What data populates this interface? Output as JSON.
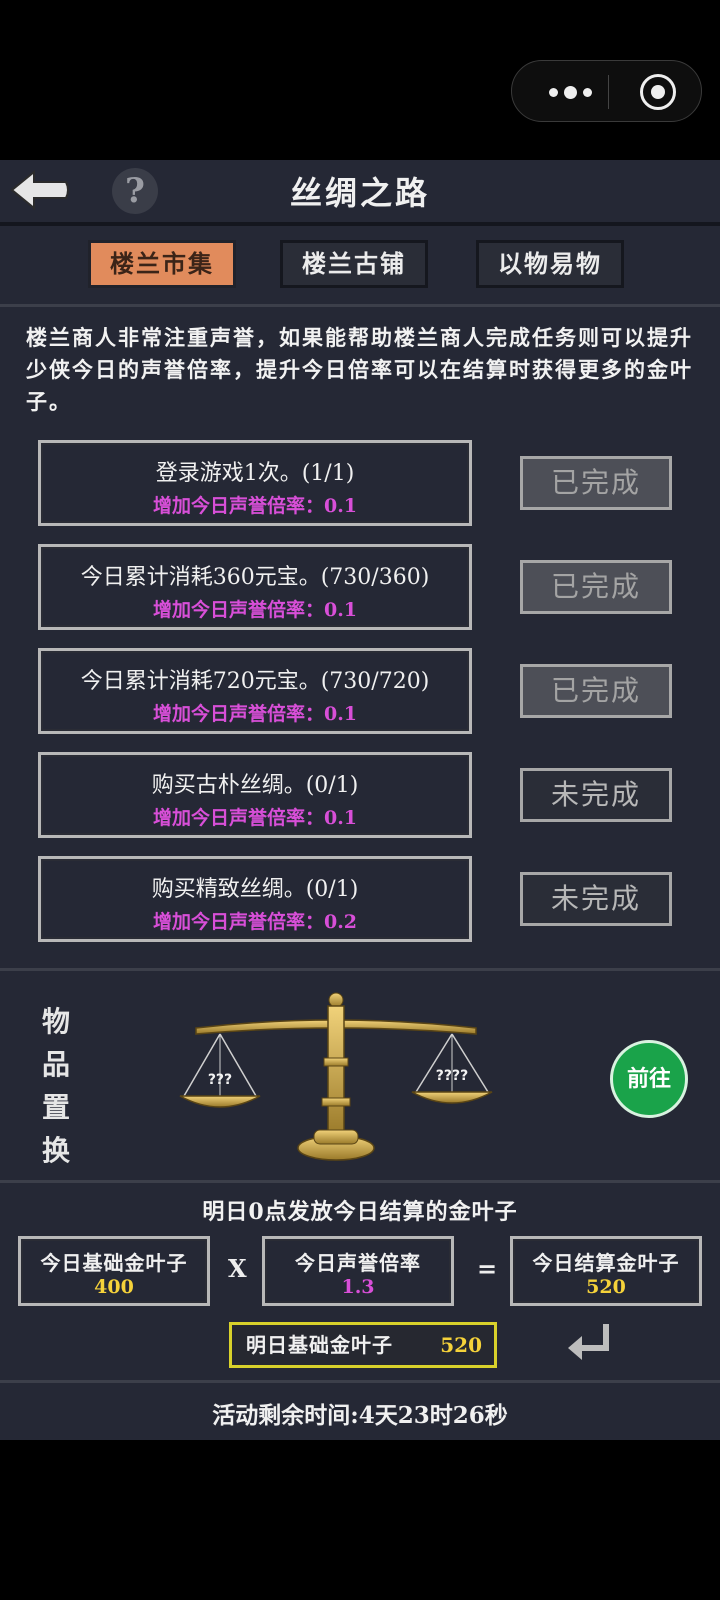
{
  "capsule": {
    "more_icon": "more-dots-icon",
    "close_icon": "target-icon"
  },
  "header": {
    "title": "丝绸之路",
    "back_icon": "back-arrow-icon",
    "help_icon": "question-icon",
    "help_glyph": "?"
  },
  "tabs": [
    {
      "label": "楼兰市集",
      "active": true
    },
    {
      "label": "楼兰古铺",
      "active": false
    },
    {
      "label": "以物易物",
      "active": false
    }
  ],
  "intro": "楼兰商人非常注重声誉，如果能帮助楼兰商人完成任务则可以提升少侠今日的声誉倍率，提升今日倍率可以在结算时获得更多的金叶子。",
  "tasks": [
    {
      "title": "登录游戏1次。(1/1)",
      "reward": "增加今日声誉倍率：0.1",
      "status": "已完成",
      "done": true
    },
    {
      "title": "今日累计消耗360元宝。(730/360)",
      "reward": "增加今日声誉倍率：0.1",
      "status": "已完成",
      "done": true
    },
    {
      "title": "今日累计消耗720元宝。(730/720)",
      "reward": "增加今日声誉倍率：0.1",
      "status": "已完成",
      "done": true
    },
    {
      "title": "购买古朴丝绸。(0/1)",
      "reward": "增加今日声誉倍率：0.1",
      "status": "未完成",
      "done": false
    },
    {
      "title": "购买精致丝绸。(0/1)",
      "reward": "增加今日声誉倍率：0.2",
      "status": "未完成",
      "done": false
    }
  ],
  "exchange": {
    "label_chars": [
      "物",
      "品",
      "置",
      "换"
    ],
    "left_pan": "???",
    "right_pan": "????",
    "go_label": "前往"
  },
  "settlement": {
    "title": "明日0点发放今日结算的金叶子",
    "base_label": "今日基础金叶子",
    "base_value": "400",
    "times": "X",
    "rate_label": "今日声誉倍率",
    "rate_value": "1.3",
    "equals": "=",
    "result_label": "今日结算金叶子",
    "result_value": "520",
    "tomorrow_label": "明日基础金叶子",
    "tomorrow_value": "520",
    "enter_icon": "return-icon"
  },
  "remaining": "活动剩余时间:4天23时26秒",
  "colors": {
    "accent_tab": "#e18b5c",
    "reward": "#d84fd8",
    "gold": "#f5d23a",
    "go_button": "#1aa34a",
    "background": "#252835"
  }
}
